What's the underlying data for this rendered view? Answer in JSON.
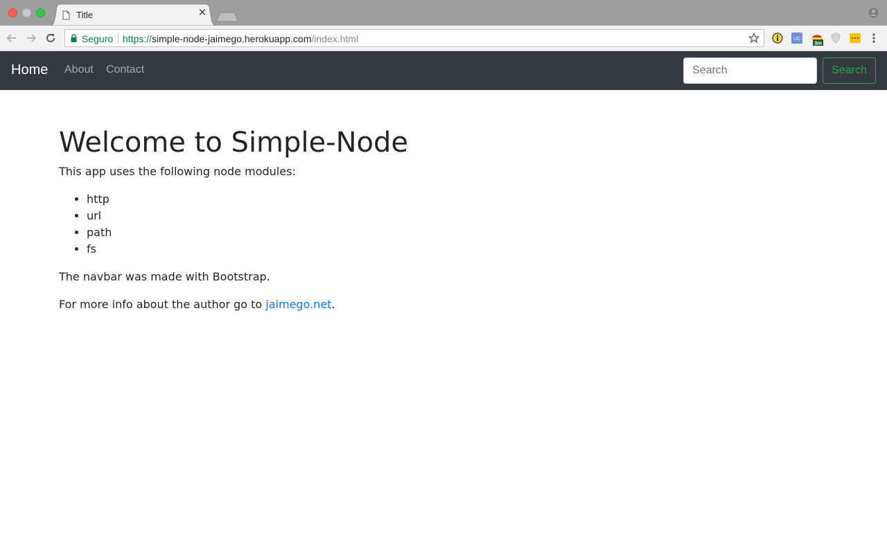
{
  "browser": {
    "tab_title": "Title",
    "secure_label": "Seguro",
    "url_scheme": "https://",
    "url_host": "simple-node-jaimego.herokuapp.com",
    "url_path": "/index.html",
    "ext_uc_label": "UC",
    "ext_badge": "3m"
  },
  "navbar": {
    "brand": "Home",
    "links": [
      "About",
      "Contact"
    ],
    "search_placeholder": "Search",
    "search_button": "Search",
    "background": "#343a40",
    "accent": "#28a745"
  },
  "content": {
    "heading": "Welcome to Simple-Node",
    "intro": "This app uses the following node modules:",
    "modules": [
      "http",
      "url",
      "path",
      "fs"
    ],
    "navbar_note": "The navbar was made with Bootstrap.",
    "author_prefix": "For more info about the author go to ",
    "author_link": "jaimego.net",
    "author_suffix": ".",
    "link_color": "#007bff"
  }
}
